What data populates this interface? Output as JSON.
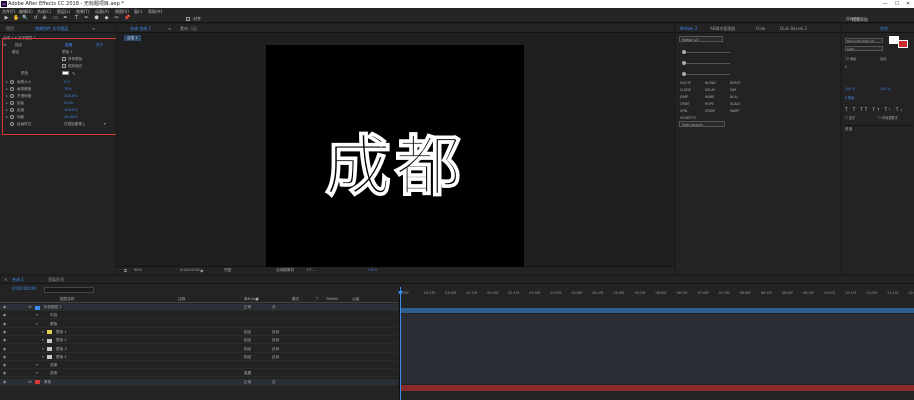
{
  "window": {
    "title": "Adobe After Effects CC 2018 - 无标题项目.aep *",
    "logo_text": "Ae",
    "minimize": "—",
    "maximize": "☐",
    "close": "✕"
  },
  "menu": [
    "文件(F)",
    "编辑(E)",
    "合成(C)",
    "图层(L)",
    "效果(T)",
    "动画(A)",
    "视图(V)",
    "窗口",
    "帮助(H)"
  ],
  "toolbar": {
    "tools": [
      "▶",
      "✋",
      "🔍",
      "↺",
      "⊕",
      "▭",
      "✒",
      "T",
      "✏",
      "⬢",
      "◆",
      "✂",
      "📌"
    ],
    "snap_label": "对齐",
    "right_label": "搜索帮助"
  },
  "effect_controls": {
    "tabs": [
      "项目",
      "效果控件 文字图层",
      "≡"
    ],
    "layer_path": "合成 1 • 文字图层 1",
    "effect_name": "描边",
    "reset_label": "重置",
    "about_label": "关于",
    "path_label": "路径",
    "path_value": "蒙版 1",
    "checkbox_all_masks": "所有蒙版",
    "checkbox_seq": "顺序描边",
    "color_label": "颜色",
    "props": [
      {
        "label": "画笔大小",
        "value": "2.0"
      },
      {
        "label": "画笔硬度",
        "value": "75%"
      },
      {
        "label": "不透明度",
        "value": "100.0%"
      },
      {
        "label": "起始",
        "value": "0.0%"
      },
      {
        "label": "结束",
        "value": "100.0%"
      },
      {
        "label": "间距",
        "value": "15.00%"
      }
    ],
    "paint_style_label": "绘画样式",
    "paint_style_value": "在原始图像上"
  },
  "composition": {
    "tabs": [
      "合成 合成 1",
      "≡",
      "素材（无）"
    ],
    "sub_tab": "合成 1",
    "text": "成都",
    "footer": {
      "zoom": "50%",
      "timecode": "0:00:00:00",
      "quality": "完整",
      "camera": "活动摄像机",
      "views": "1个…",
      "offset": "+0.0"
    }
  },
  "right_panels": {
    "motion_tabs": [
      "Motion 2",
      "AE脚本管理器",
      "Flow",
      "Duik Bassel.2"
    ],
    "motion_version": "Motion v2",
    "fx_buttons": [
      "EXCITE",
      "BLEND",
      "BURST",
      "CLONE",
      "DELAY",
      "DIM",
      "JUMP",
      "NAME",
      "NULL",
      "ORBIT",
      "ROPE",
      "SCALE",
      "SPIN",
      "STARE",
      "WARP",
      "VIGNETTE"
    ],
    "task_launch": "Task Launch",
    "char_tab": "字符",
    "search_help": "搜索帮助",
    "font_name": "Microsoft YaHei UI",
    "font_style": "Light",
    "font_size": "72 像素",
    "leading": "自动",
    "tracking": "0",
    "percent_a": "100 %",
    "percent_b": "100 %",
    "baseline": "0 像素",
    "paragraph_tab": "段落",
    "ligatures": "连字",
    "hindi": "印地语数字"
  },
  "timeline": {
    "tabs": [
      "合成 1",
      "渲染队列"
    ],
    "timecode": "0:00:00:00",
    "columns": [
      "图层名称",
      "注释",
      "单⊕\\fx■",
      "模式",
      "T",
      "TrkMat",
      "父级"
    ],
    "rows": [
      {
        "num": "1",
        "name": "形状图层 1",
        "mode": "正常",
        "parent": "无",
        "indent": 0,
        "color": "#3d8cf0"
      },
      {
        "num": "",
        "name": "内容",
        "mode": "",
        "parent": "",
        "indent": 1,
        "color": ""
      },
      {
        "num": "",
        "name": "蒙版",
        "mode": "",
        "parent": "",
        "indent": 1,
        "color": ""
      },
      {
        "num": "",
        "name": "蒙版 1",
        "mode": "相加",
        "parent": "反转",
        "indent": 2,
        "color": "#e6d24a"
      },
      {
        "num": "",
        "name": "蒙版 2",
        "mode": "相加",
        "parent": "反转",
        "indent": 2,
        "color": "#c9c9c9"
      },
      {
        "num": "",
        "name": "蒙版 3",
        "mode": "相加",
        "parent": "反转",
        "indent": 2,
        "color": "#c9c9c9"
      },
      {
        "num": "",
        "name": "蒙版 4",
        "mode": "相加",
        "parent": "反转",
        "indent": 2,
        "color": "#c9c9c9"
      },
      {
        "num": "",
        "name": "效果",
        "mode": "",
        "parent": "",
        "indent": 1,
        "color": ""
      },
      {
        "num": "",
        "name": "变换",
        "mode": "重置",
        "parent": "",
        "indent": 1,
        "color": ""
      },
      {
        "num": "2",
        "name": "黑色",
        "mode": "正常",
        "parent": "无",
        "indent": 0,
        "color": "#d83a3a"
      }
    ],
    "reset_label": "重置",
    "ruler": [
      "00f",
      "00:15f",
      "01:00f",
      "01:15f",
      "02:00f",
      "02:15f",
      "03:00f",
      "03:15f",
      "04:00f",
      "04:15f",
      "05:00f",
      "05:15f",
      "06:00f",
      "06:15f",
      "07:00f",
      "07:15f",
      "08:00f",
      "08:15f",
      "09:00f",
      "09:15f",
      "10:00f",
      "10:15f",
      "11:00f",
      "11:15f",
      "12:00f"
    ]
  },
  "colors": {
    "accent": "#3d8cf0",
    "highlight_box": "#d83a3a",
    "layer1_bar": "#2f5f8f",
    "layer2_bar": "#8a2b2b"
  }
}
